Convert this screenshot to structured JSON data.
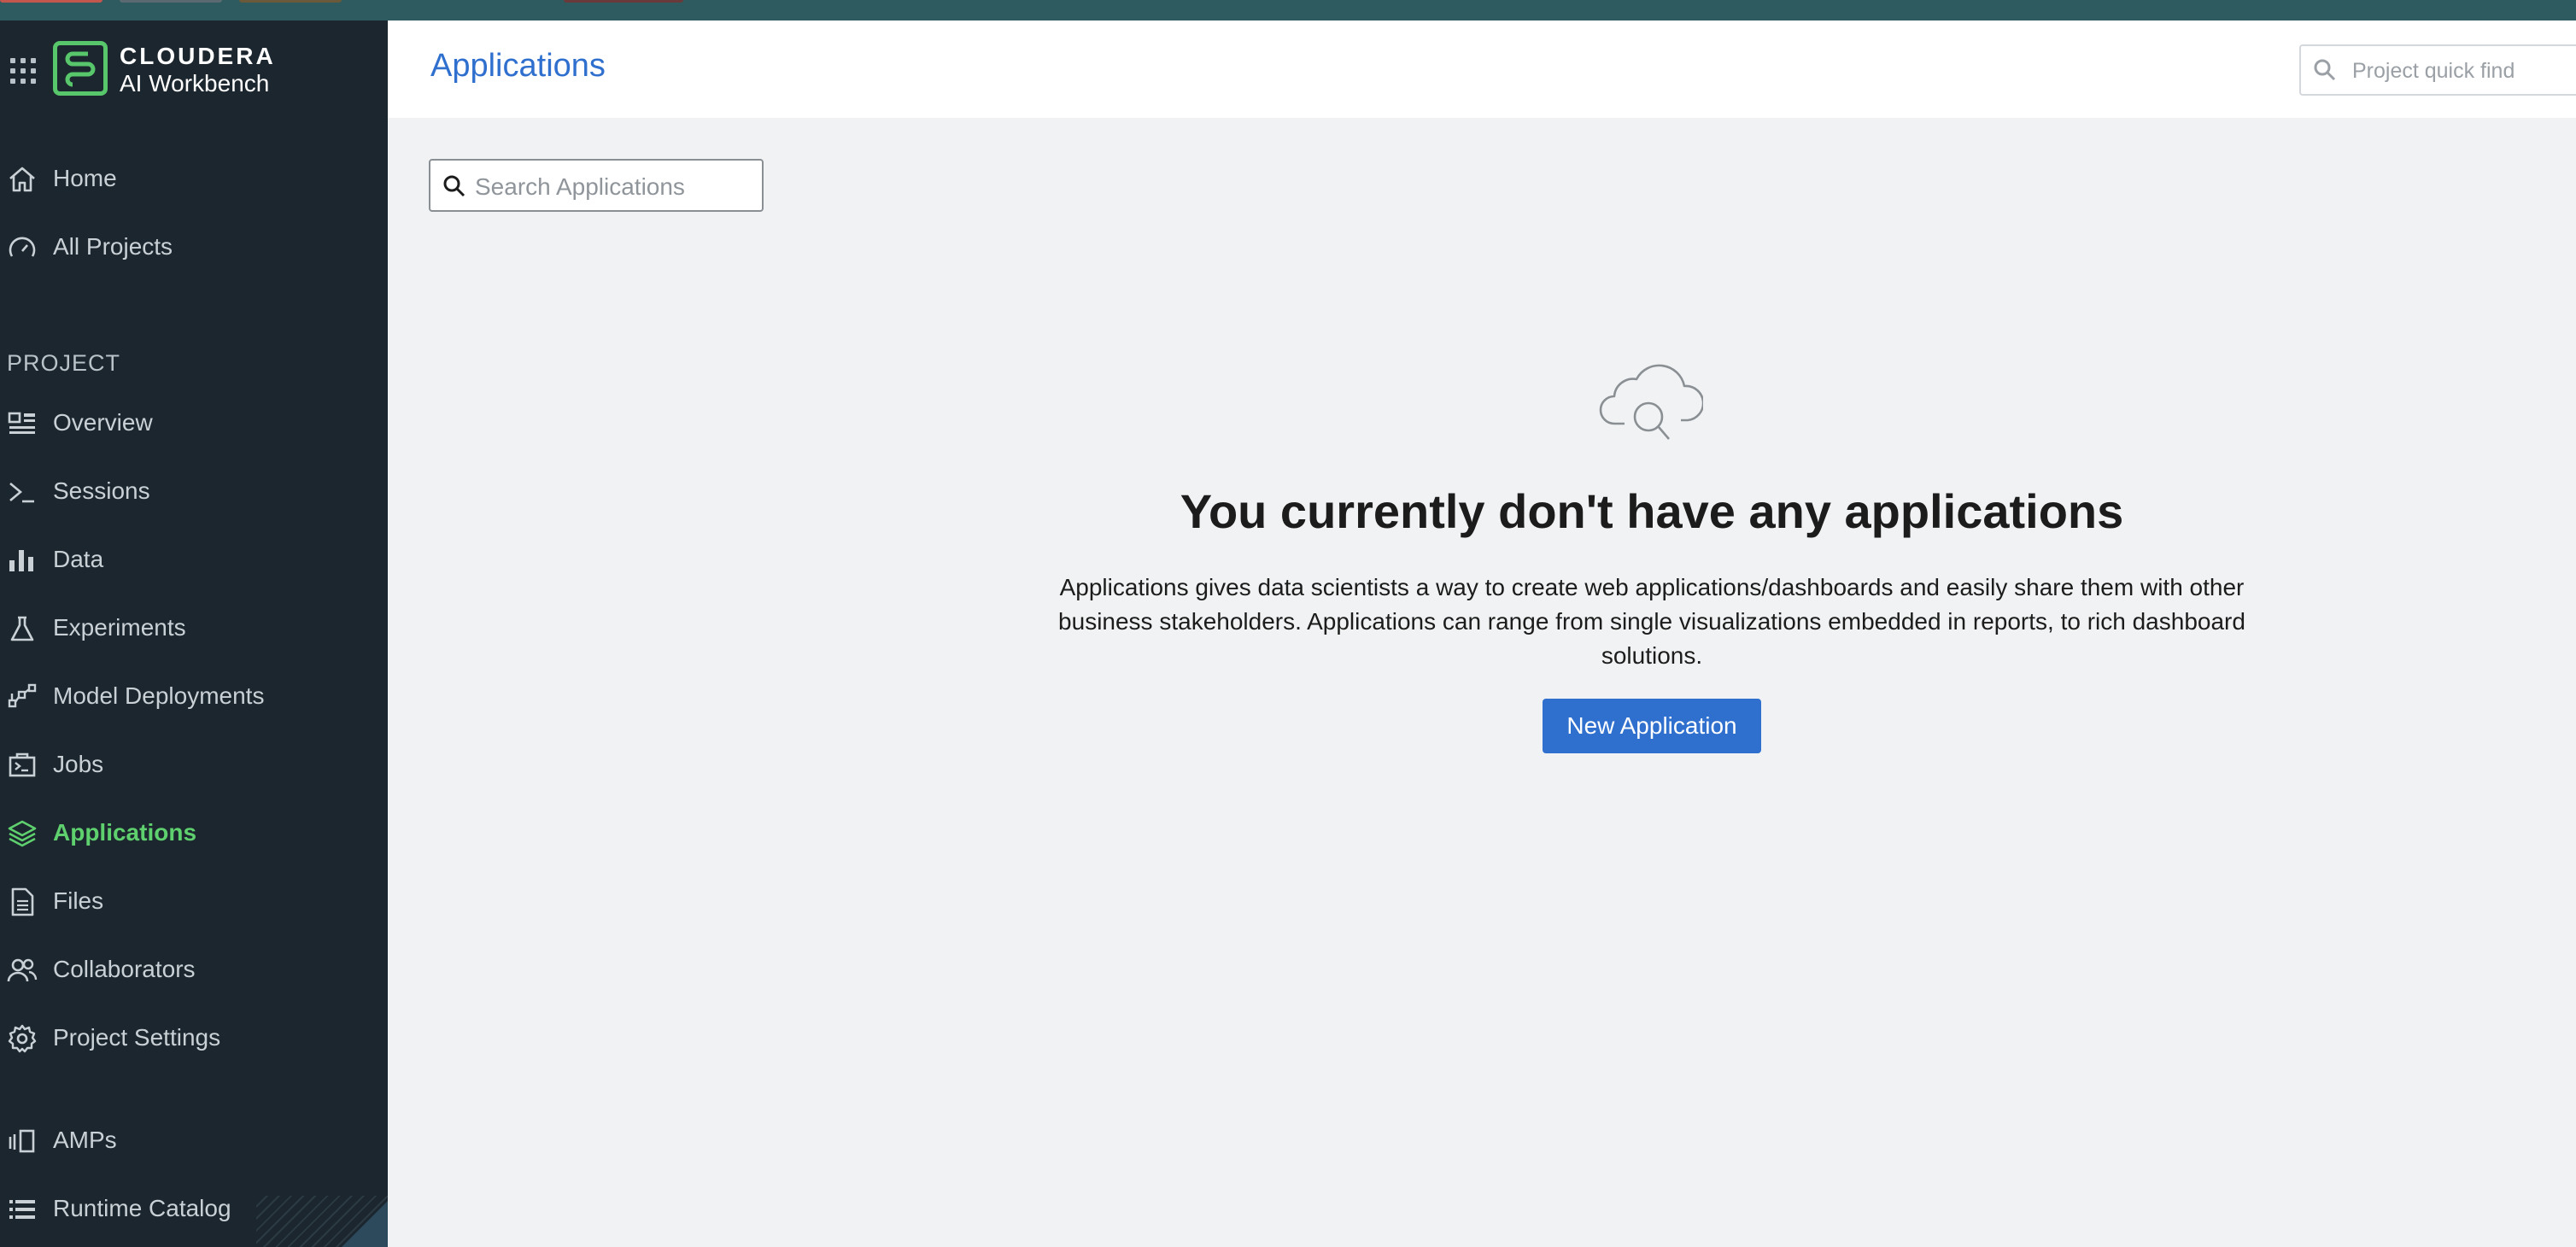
{
  "brand": {
    "line1": "CLOUDERA",
    "line2": "AI Workbench",
    "accent": "#58c66a"
  },
  "header": {
    "title": "Applications",
    "quick_find_placeholder": "Project quick find"
  },
  "sidebar": {
    "global_items": [
      {
        "label": "Home",
        "icon": "home-icon"
      },
      {
        "label": "All Projects",
        "icon": "gauge-icon"
      }
    ],
    "section_label": "PROJECT",
    "project_items": [
      {
        "label": "Overview",
        "icon": "overview-icon"
      },
      {
        "label": "Sessions",
        "icon": "terminal-icon"
      },
      {
        "label": "Data",
        "icon": "bar-chart-icon"
      },
      {
        "label": "Experiments",
        "icon": "flask-icon"
      },
      {
        "label": "Model Deployments",
        "icon": "network-icon"
      },
      {
        "label": "Jobs",
        "icon": "jobs-icon"
      },
      {
        "label": "Applications",
        "icon": "layers-icon",
        "active": true
      },
      {
        "label": "Files",
        "icon": "file-icon"
      },
      {
        "label": "Collaborators",
        "icon": "people-icon"
      },
      {
        "label": "Project Settings",
        "icon": "gear-icon"
      }
    ],
    "bottom_items": [
      {
        "label": "AMPs",
        "icon": "amps-icon"
      },
      {
        "label": "Runtime Catalog",
        "icon": "list-icon"
      }
    ]
  },
  "main": {
    "search_placeholder": "Search Applications",
    "empty_title": "You currently don't have any applications",
    "empty_description": "Applications gives data scientists a way to create web applications/dashboards and easily share them with other business stakeholders. Applications can range from single visualizations embedded in reports, to rich dashboard solutions.",
    "new_button_label": "New Application"
  },
  "colors": {
    "sidebar_bg": "#1b262e",
    "primary": "#2f6fce",
    "active_nav": "#5fd06e"
  }
}
